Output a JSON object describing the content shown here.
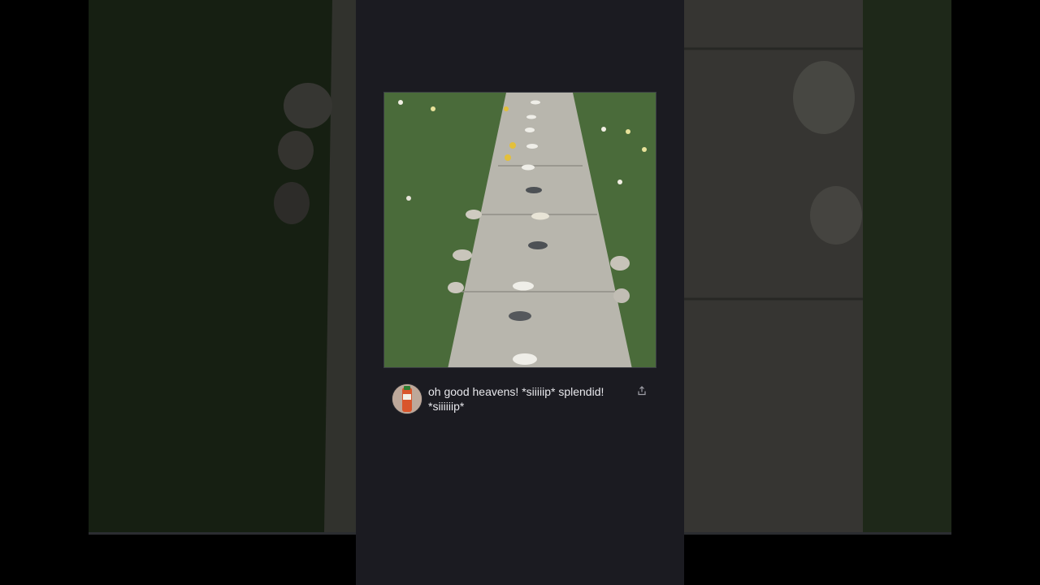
{
  "post": {
    "caption": "oh good heavens! *siiiiip* splendid! *siiiiiip*",
    "image_subject": "garden-path-with-teacups",
    "avatar_subject": "juice-bottle-avatar"
  },
  "icons": {
    "share": "share-icon"
  },
  "colors": {
    "page_background": "#000000",
    "column_background": "#1b1b21",
    "caption_text": "#e8e8ec"
  }
}
